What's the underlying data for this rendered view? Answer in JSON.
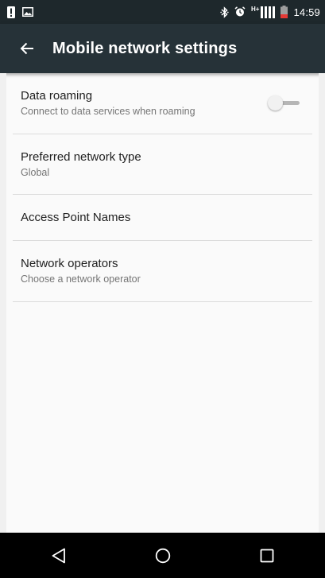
{
  "status_bar": {
    "time": "14:59",
    "network_label": "H+",
    "left_icons": [
      "alert-icon",
      "image-icon"
    ],
    "right_icons": [
      "bluetooth-icon",
      "alarm-icon",
      "signal-icon",
      "battery-low-icon"
    ],
    "colors": {
      "background": "#1e282c",
      "battery": "#e53935"
    }
  },
  "app_bar": {
    "title": "Mobile network settings",
    "back_icon": "back-arrow-icon",
    "background": "#263238"
  },
  "settings": {
    "items": [
      {
        "title": "Data roaming",
        "summary": "Connect to data services when roaming",
        "toggle": "off"
      },
      {
        "title": "Preferred network type",
        "summary": "Global"
      },
      {
        "title": "Access Point Names",
        "summary": ""
      },
      {
        "title": "Network operators",
        "summary": "Choose a network operator"
      }
    ]
  },
  "nav_bar": {
    "buttons": [
      "back-triangle-icon",
      "home-circle-icon",
      "recents-square-icon"
    ]
  }
}
